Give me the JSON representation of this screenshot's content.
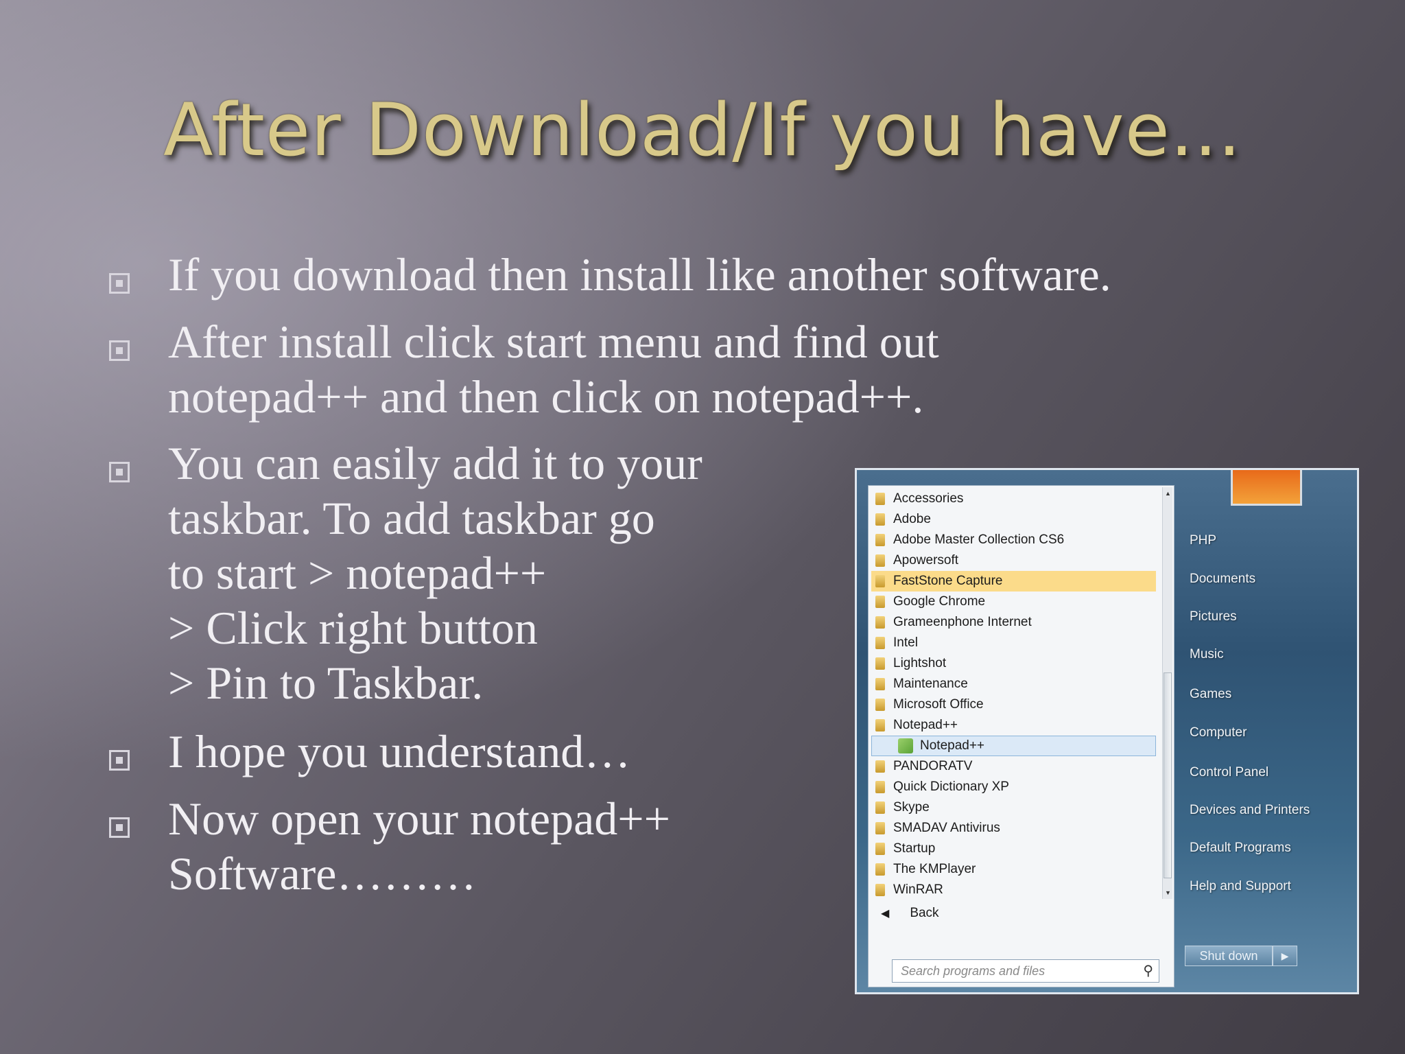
{
  "slide": {
    "title": "After Download/If you have...",
    "bullets": [
      "If you download then install like another software.",
      "After install click start menu and find out\nnotepad++ and then click on notepad++.",
      "You can easily add it to your\ntaskbar. To add taskbar go\nto start > notepad++\n> Click right button\n> Pin to Taskbar.",
      "I hope you understand…",
      "Now open your notepad++\nSoftware………"
    ]
  },
  "start_menu": {
    "programs": [
      "Accessories",
      "Adobe",
      "Adobe Master Collection CS6",
      "Apowersoft",
      "FastStone Capture",
      "Google Chrome",
      "Grameenphone Internet",
      "Intel",
      "Lightshot",
      "Maintenance",
      "Microsoft Office",
      "Notepad++",
      "Notepad++",
      "PANDORATV",
      "Quick Dictionary XP",
      "Skype",
      "SMADAV Antivirus",
      "Startup",
      "The KMPlayer",
      "WinRAR"
    ],
    "highlighted_item": "FastStone Capture",
    "selected_item": "Notepad++",
    "back_label": "Back",
    "search_placeholder": "Search programs and files",
    "right_links": [
      "PHP",
      "Documents",
      "Pictures",
      "Music",
      "Games",
      "Computer",
      "Control Panel",
      "Devices and Printers",
      "Default Programs",
      "Help and Support"
    ],
    "shutdown_label": "Shut down",
    "icons": {
      "folder": "folder-icon",
      "app": "notepad-plus-plus-icon",
      "search": "search-icon",
      "back": "back-arrow-icon"
    }
  }
}
